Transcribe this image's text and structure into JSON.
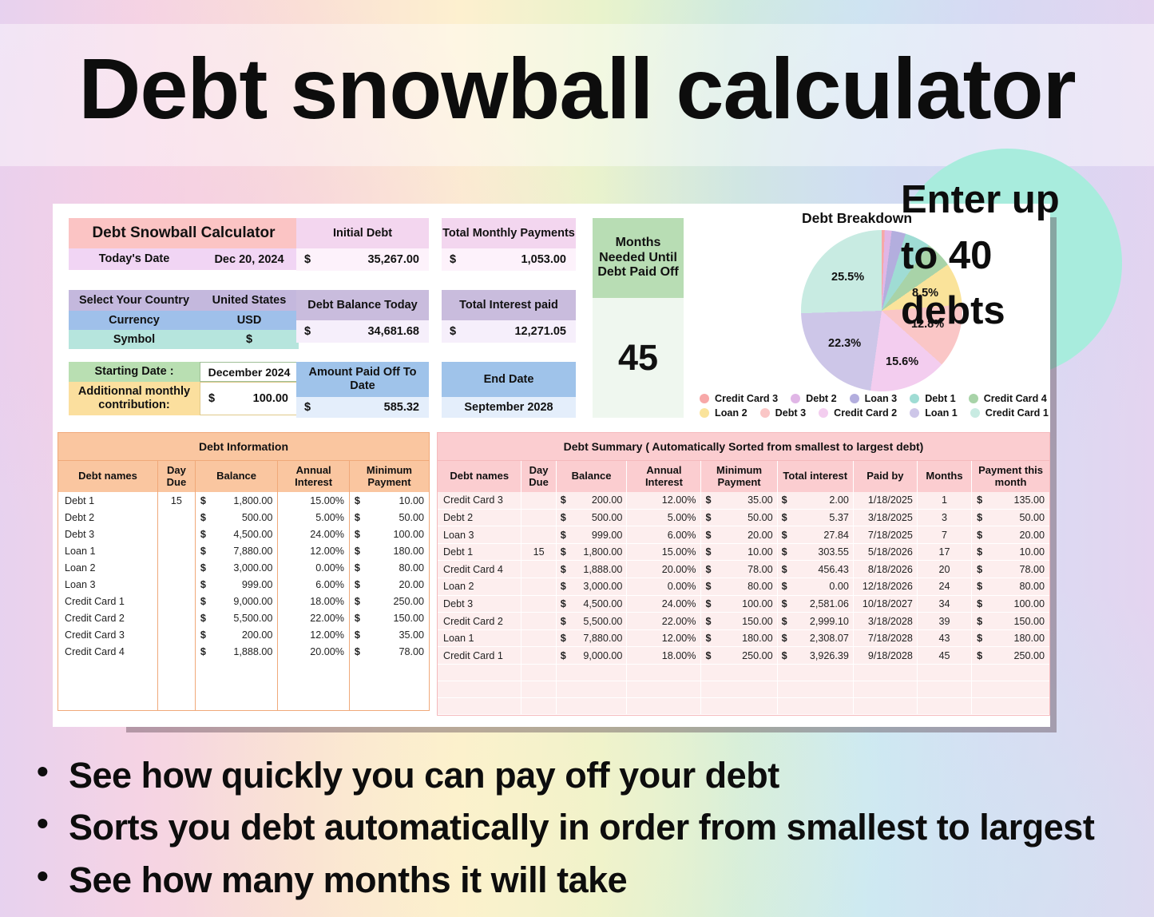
{
  "title": "Debt snowball calculator",
  "badge": {
    "lines": [
      "Enter up",
      "to 40",
      "debts"
    ]
  },
  "info": {
    "calculator_title": "Debt Snowball Calculator",
    "todays_date_label": "Today's Date",
    "todays_date_value": "Dec 20, 2024",
    "country_label": "Select Your Country",
    "country_value": "United States",
    "currency_label": "Currency",
    "currency_value": "USD",
    "symbol_label": "Symbol",
    "symbol_value": "$",
    "starting_date_label": "Starting Date :",
    "starting_date_value": "December 2024",
    "extra_contribution_label": "Additionnal monthly contribution:",
    "extra_contribution_symbol": "$",
    "extra_contribution_value": "100.00"
  },
  "stats": {
    "initial_debt_label": "Initial Debt",
    "initial_debt_symbol": "$",
    "initial_debt_value": "35,267.00",
    "total_monthly_label": "Total Monthly Payments",
    "total_monthly_symbol": "$",
    "total_monthly_value": "1,053.00",
    "balance_today_label": "Debt Balance Today",
    "balance_today_symbol": "$",
    "balance_today_value": "34,681.68",
    "total_interest_label": "Total Interest paid",
    "total_interest_symbol": "$",
    "total_interest_value": "12,271.05",
    "paid_off_label": "Amount Paid Off To Date",
    "paid_off_symbol": "$",
    "paid_off_value": "585.32",
    "end_date_label": "End Date",
    "end_date_value": "September 2028",
    "months_label": "Months Needed Until Debt Paid Off",
    "months_value": "45"
  },
  "debt_info": {
    "title": "Debt Information",
    "columns": [
      "Debt names",
      "Day Due",
      "Balance",
      "Annual Interest",
      "Minimum Payment"
    ],
    "rows": [
      {
        "name": "Debt 1",
        "day": "15",
        "cur": "$",
        "balance": "1,800.00",
        "interest": "15.00%",
        "mcur": "$",
        "minimum": "10.00"
      },
      {
        "name": "Debt 2",
        "day": "",
        "cur": "$",
        "balance": "500.00",
        "interest": "5.00%",
        "mcur": "$",
        "minimum": "50.00"
      },
      {
        "name": "Debt 3",
        "day": "",
        "cur": "$",
        "balance": "4,500.00",
        "interest": "24.00%",
        "mcur": "$",
        "minimum": "100.00"
      },
      {
        "name": "Loan 1",
        "day": "",
        "cur": "$",
        "balance": "7,880.00",
        "interest": "12.00%",
        "mcur": "$",
        "minimum": "180.00"
      },
      {
        "name": "Loan 2",
        "day": "",
        "cur": "$",
        "balance": "3,000.00",
        "interest": "0.00%",
        "mcur": "$",
        "minimum": "80.00"
      },
      {
        "name": "Loan 3",
        "day": "",
        "cur": "$",
        "balance": "999.00",
        "interest": "6.00%",
        "mcur": "$",
        "minimum": "20.00"
      },
      {
        "name": "Credit Card 1",
        "day": "",
        "cur": "$",
        "balance": "9,000.00",
        "interest": "18.00%",
        "mcur": "$",
        "minimum": "250.00"
      },
      {
        "name": "Credit Card 2",
        "day": "",
        "cur": "$",
        "balance": "5,500.00",
        "interest": "22.00%",
        "mcur": "$",
        "minimum": "150.00"
      },
      {
        "name": "Credit Card 3",
        "day": "",
        "cur": "$",
        "balance": "200.00",
        "interest": "12.00%",
        "mcur": "$",
        "minimum": "35.00"
      },
      {
        "name": "Credit Card 4",
        "day": "",
        "cur": "$",
        "balance": "1,888.00",
        "interest": "20.00%",
        "mcur": "$",
        "minimum": "78.00"
      }
    ]
  },
  "debt_summary": {
    "title": "Debt Summary ( Automatically Sorted from smallest to largest debt)",
    "columns": [
      "Debt names",
      "Day Due",
      "Balance",
      "Annual Interest",
      "Minimum Payment",
      "Total interest",
      "Paid by",
      "Months",
      "Payment this month"
    ],
    "rows": [
      {
        "name": "Credit Card 3",
        "day": "",
        "cur": "$",
        "balance": "200.00",
        "interest": "12.00%",
        "mcur": "$",
        "minimum": "35.00",
        "icur": "$",
        "total_interest": "2.00",
        "paid_by": "1/18/2025",
        "months": "1",
        "pcur": "$",
        "payment": "135.00"
      },
      {
        "name": "Debt 2",
        "day": "",
        "cur": "$",
        "balance": "500.00",
        "interest": "5.00%",
        "mcur": "$",
        "minimum": "50.00",
        "icur": "$",
        "total_interest": "5.37",
        "paid_by": "3/18/2025",
        "months": "3",
        "pcur": "$",
        "payment": "50.00"
      },
      {
        "name": "Loan 3",
        "day": "",
        "cur": "$",
        "balance": "999.00",
        "interest": "6.00%",
        "mcur": "$",
        "minimum": "20.00",
        "icur": "$",
        "total_interest": "27.84",
        "paid_by": "7/18/2025",
        "months": "7",
        "pcur": "$",
        "payment": "20.00"
      },
      {
        "name": "Debt 1",
        "day": "15",
        "cur": "$",
        "balance": "1,800.00",
        "interest": "15.00%",
        "mcur": "$",
        "minimum": "10.00",
        "icur": "$",
        "total_interest": "303.55",
        "paid_by": "5/18/2026",
        "months": "17",
        "pcur": "$",
        "payment": "10.00"
      },
      {
        "name": "Credit Card 4",
        "day": "",
        "cur": "$",
        "balance": "1,888.00",
        "interest": "20.00%",
        "mcur": "$",
        "minimum": "78.00",
        "icur": "$",
        "total_interest": "456.43",
        "paid_by": "8/18/2026",
        "months": "20",
        "pcur": "$",
        "payment": "78.00"
      },
      {
        "name": "Loan 2",
        "day": "",
        "cur": "$",
        "balance": "3,000.00",
        "interest": "0.00%",
        "mcur": "$",
        "minimum": "80.00",
        "icur": "$",
        "total_interest": "0.00",
        "paid_by": "12/18/2026",
        "months": "24",
        "pcur": "$",
        "payment": "80.00"
      },
      {
        "name": "Debt 3",
        "day": "",
        "cur": "$",
        "balance": "4,500.00",
        "interest": "24.00%",
        "mcur": "$",
        "minimum": "100.00",
        "icur": "$",
        "total_interest": "2,581.06",
        "paid_by": "10/18/2027",
        "months": "34",
        "pcur": "$",
        "payment": "100.00"
      },
      {
        "name": "Credit Card 2",
        "day": "",
        "cur": "$",
        "balance": "5,500.00",
        "interest": "22.00%",
        "mcur": "$",
        "minimum": "150.00",
        "icur": "$",
        "total_interest": "2,999.10",
        "paid_by": "3/18/2028",
        "months": "39",
        "pcur": "$",
        "payment": "150.00"
      },
      {
        "name": "Loan 1",
        "day": "",
        "cur": "$",
        "balance": "7,880.00",
        "interest": "12.00%",
        "mcur": "$",
        "minimum": "180.00",
        "icur": "$",
        "total_interest": "2,308.07",
        "paid_by": "7/18/2028",
        "months": "43",
        "pcur": "$",
        "payment": "180.00"
      },
      {
        "name": "Credit Card 1",
        "day": "",
        "cur": "$",
        "balance": "9,000.00",
        "interest": "18.00%",
        "mcur": "$",
        "minimum": "250.00",
        "icur": "$",
        "total_interest": "3,926.39",
        "paid_by": "9/18/2028",
        "months": "45",
        "pcur": "$",
        "payment": "250.00"
      }
    ]
  },
  "chart_data": {
    "type": "pie",
    "title": "Debt Breakdown",
    "legend_position": "bottom",
    "categories": [
      "Credit Card 3",
      "Debt 2",
      "Loan 3",
      "Debt 1",
      "Credit Card 4",
      "Loan 2",
      "Debt 3",
      "Credit Card 2",
      "Loan 1",
      "Credit Card 1"
    ],
    "values": [
      0.6,
      1.4,
      2.8,
      5.1,
      5.4,
      8.5,
      12.8,
      15.6,
      22.3,
      25.5
    ],
    "visible_labels": [
      "8.5%",
      "12.8%",
      "15.6%",
      "22.3%",
      "25.5%"
    ],
    "colors": [
      "#f7a8a8",
      "#e0b6e6",
      "#b3aede",
      "#9fdcd4",
      "#a8d3a8",
      "#fae39a",
      "#fac6c6",
      "#f3cdef",
      "#cdc6e8",
      "#c8ebe2"
    ],
    "legend": [
      {
        "label": "Credit Card 3",
        "color": "#f7a8a8"
      },
      {
        "label": "Debt 2",
        "color": "#e0b6e6"
      },
      {
        "label": "Loan 3",
        "color": "#b3aede"
      },
      {
        "label": "Debt 1",
        "color": "#9fdcd4"
      },
      {
        "label": "Credit Card 4",
        "color": "#a8d3a8"
      },
      {
        "label": "Loan 2",
        "color": "#fae39a"
      },
      {
        "label": "Debt 3",
        "color": "#fac6c6"
      },
      {
        "label": "Credit Card 2",
        "color": "#f3cdef"
      },
      {
        "label": "Loan 1",
        "color": "#cdc6e8"
      },
      {
        "label": "Credit Card 1",
        "color": "#c8ebe2"
      }
    ]
  },
  "bullets": [
    "See how quickly you can pay off your debt",
    "Sorts you debt automatically in order from smallest to largest",
    "See how many months it will take"
  ]
}
